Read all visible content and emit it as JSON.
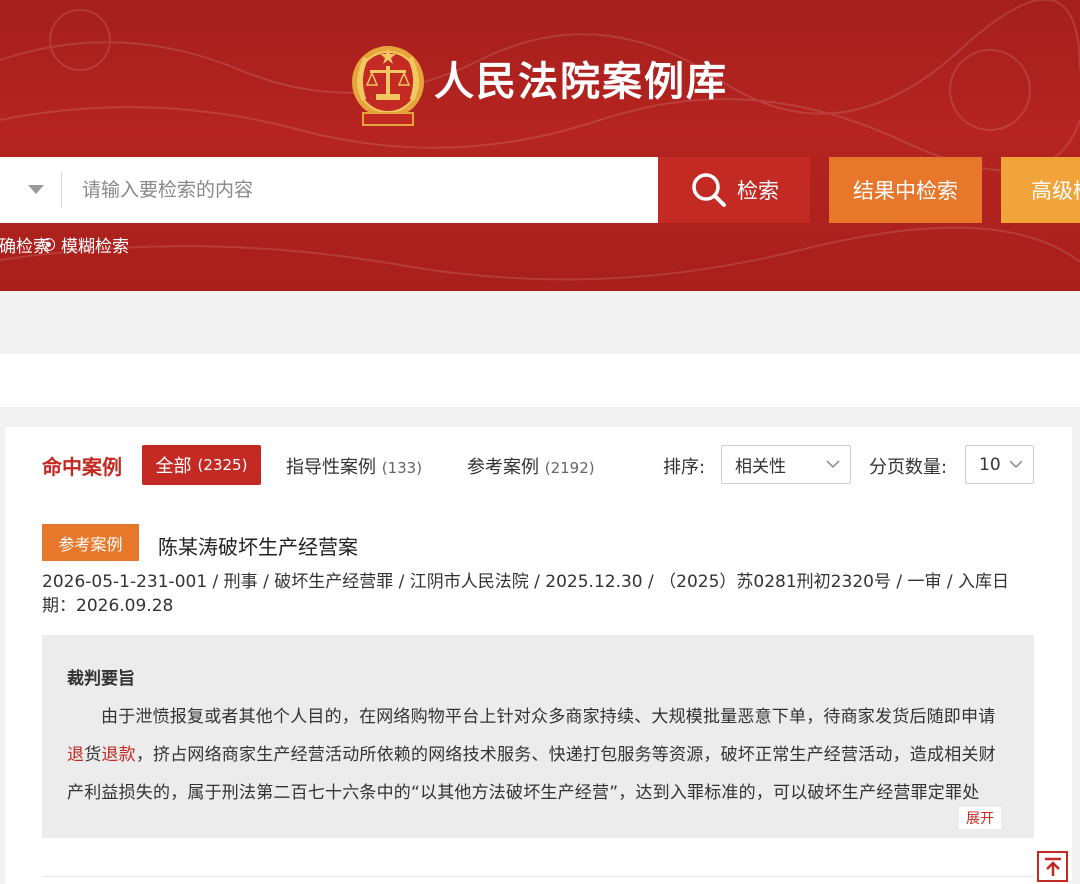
{
  "header": {
    "site_title": "人民法院案例库"
  },
  "search": {
    "placeholder": "请输入要检索的内容",
    "search_button": "检索",
    "within_results_button": "结果中检索",
    "advanced_button": "高级检索",
    "mode_exact": "精确检索",
    "mode_fuzzy": "模糊检索",
    "selected_mode": "模糊检索"
  },
  "results": {
    "hits_title": "命中案例",
    "tabs": [
      {
        "label": "全部",
        "count": "(2325)",
        "active": true
      },
      {
        "label": "指导性案例",
        "count": "(133)",
        "active": false
      },
      {
        "label": "参考案例",
        "count": "(2192)",
        "active": false
      }
    ],
    "sort_label": "排序:",
    "sort_value": "相关性",
    "page_size_label": "分页数量:",
    "page_size_value": "10"
  },
  "case": {
    "badge": "参考案例",
    "title": "陈某涛破坏生产经营案",
    "meta": "2026-05-1-231-001 / 刑事 / 破坏生产经营罪 / 江阴市人民法院 / 2025.12.30 / （2025）苏0281刑初2320号 / 一审 / 入库日期：2026.09.28",
    "summary_heading": "裁判要旨",
    "summary_before": "由于泄愤报复或者其他个人目的，在网络购物平台上针对众多商家持续、大规模批量恶意下单，待商家发货后随即申请",
    "summary_hl1": "退",
    "summary_mid": "货",
    "summary_hl2": "退款",
    "summary_after": "，挤占网络商家生产经营活动所依赖的网络技术服务、快递打包服务等资源，破坏正常生产经营活动，造成相关财产利益损失的，属于刑法第二百七十六条中的“以其他方法破坏生产经营”，达到入罪标准的，可以破坏生产经营罪定罪处罚。",
    "expand_label": "展开"
  },
  "colors": {
    "brand_red": "#c22a23",
    "orange": "#e6772b",
    "light_orange": "#f0a43a",
    "header_bg": "#b52420"
  },
  "icons": {
    "logo": "court-emblem-icon",
    "search": "search-icon",
    "back_to_top": "back-to-top-icon"
  }
}
